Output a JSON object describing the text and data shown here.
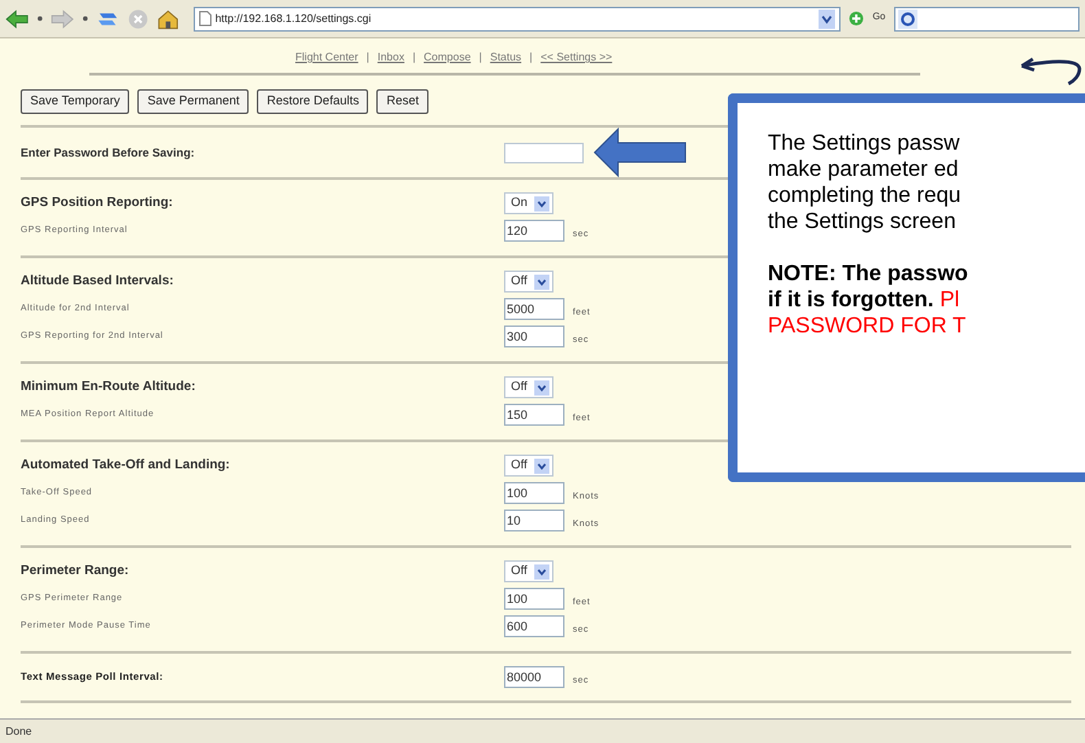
{
  "browser": {
    "url": "http://192.168.1.120/settings.cgi",
    "go_label": "Go"
  },
  "nav": {
    "separator": "|",
    "links": [
      "Flight Center",
      "Inbox",
      "Compose",
      "Status",
      "<< Settings >>"
    ]
  },
  "buttons": [
    "Save Temporary",
    "Save Permanent",
    "Restore Defaults",
    "Reset"
  ],
  "password": {
    "label": "Enter Password Before Saving:"
  },
  "sections": [
    {
      "kind": "toggle",
      "title": "GPS Position Reporting:",
      "toggle": "On",
      "fields": [
        {
          "label": "GPS Reporting Interval",
          "value": "120",
          "unit": "sec"
        }
      ]
    },
    {
      "kind": "toggle",
      "title": "Altitude Based Intervals:",
      "toggle": "Off",
      "fields": [
        {
          "label": "Altitude for 2nd Interval",
          "value": "5000",
          "unit": "feet"
        },
        {
          "label": "GPS Reporting for 2nd Interval",
          "value": "300",
          "unit": "sec"
        }
      ]
    },
    {
      "kind": "toggle",
      "title": "Minimum En-Route Altitude:",
      "toggle": "Off",
      "fields": [
        {
          "label": "MEA Position Report Altitude",
          "value": "150",
          "unit": "feet"
        }
      ]
    },
    {
      "kind": "toggle",
      "title": "Automated Take-Off and Landing:",
      "toggle": "Off",
      "fields": [
        {
          "label": "Take-Off Speed",
          "value": "100",
          "unit": "Knots"
        },
        {
          "label": "Landing Speed",
          "value": "10",
          "unit": "Knots"
        }
      ]
    },
    {
      "kind": "toggle",
      "title": "Perimeter Range:",
      "toggle": "Off",
      "fields": [
        {
          "label": "GPS Perimeter Range",
          "value": "100",
          "unit": "feet"
        },
        {
          "label": "Perimeter Mode Pause Time",
          "value": "600",
          "unit": "sec"
        }
      ]
    },
    {
      "kind": "single",
      "title": "Text Message Poll Interval:",
      "value": "80000",
      "unit": "sec"
    }
  ],
  "callout": {
    "paragraphs": [
      [
        [
          {
            "kind": "body",
            "text": "The Settings passw"
          }
        ],
        [
          {
            "kind": "body",
            "text": "make parameter ed"
          }
        ],
        [
          {
            "kind": "body",
            "text": "completing the requ"
          }
        ],
        [
          {
            "kind": "body",
            "text": "the Settings screen"
          }
        ]
      ],
      [
        [
          {
            "kind": "note",
            "text": "NOTE: The passwo"
          }
        ],
        [
          {
            "kind": "note",
            "text": "if it is forgotten."
          },
          {
            "kind": "warning",
            "text": " Pl"
          }
        ],
        [
          {
            "kind": "warning",
            "text": "PASSWORD FOR T"
          }
        ]
      ]
    ]
  },
  "status_bar": "Done"
}
